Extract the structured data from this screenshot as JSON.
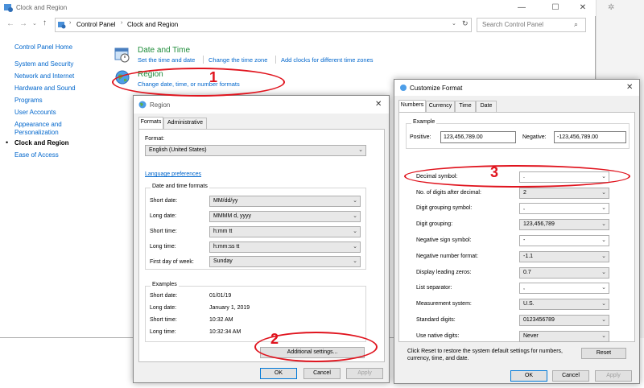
{
  "cp": {
    "title": "Clock and Region",
    "breadcrumb": [
      "Control Panel",
      "Clock and Region"
    ],
    "search_placeholder": "Search Control Panel",
    "nav": [
      "Control Panel Home",
      "System and Security",
      "Network and Internet",
      "Hardware and Sound",
      "Programs",
      "User Accounts",
      "Appearance and Personalization",
      "Clock and Region",
      "Ease of Access"
    ],
    "dt": {
      "heading": "Date and Time",
      "links": [
        "Set the time and date",
        "Change the time zone",
        "Add clocks for different time zones"
      ]
    },
    "region": {
      "heading": "Region",
      "link": "Change date, time, or number formats"
    }
  },
  "region_dlg": {
    "title": "Region",
    "tabs": [
      "Formats",
      "Administrative"
    ],
    "format_label": "Format:",
    "format_value": "English (United States)",
    "lang_pref": "Language preferences",
    "dtf_group": "Date and time formats",
    "rows": [
      {
        "label": "Short date:",
        "value": "MM/dd/yy"
      },
      {
        "label": "Long date:",
        "value": "MMMM d, yyyy"
      },
      {
        "label": "Short time:",
        "value": "h:mm tt"
      },
      {
        "label": "Long time:",
        "value": "h:mm:ss tt"
      },
      {
        "label": "First day of week:",
        "value": "Sunday"
      }
    ],
    "examples_group": "Examples",
    "examples": [
      {
        "label": "Short date:",
        "value": "01/01/19"
      },
      {
        "label": "Long date:",
        "value": "January 1, 2019"
      },
      {
        "label": "Short time:",
        "value": "10:32 AM"
      },
      {
        "label": "Long time:",
        "value": "10:32:34 AM"
      }
    ],
    "additional": "Additional settings...",
    "ok": "OK",
    "cancel": "Cancel",
    "apply": "Apply"
  },
  "cf_dlg": {
    "title": "Customize Format",
    "tabs": [
      "Numbers",
      "Currency",
      "Time",
      "Date"
    ],
    "example_group": "Example",
    "positive_label": "Positive:",
    "positive_value": "123,456,789.00",
    "negative_label": "Negative:",
    "negative_value": "-123,456,789.00",
    "rows": [
      {
        "label": "Decimal symbol:",
        "value": "."
      },
      {
        "label": "No. of digits after decimal:",
        "value": "2"
      },
      {
        "label": "Digit grouping symbol:",
        "value": ","
      },
      {
        "label": "Digit grouping:",
        "value": "123,456,789"
      },
      {
        "label": "Negative sign symbol:",
        "value": "-"
      },
      {
        "label": "Negative number format:",
        "value": "-1.1"
      },
      {
        "label": "Display leading zeros:",
        "value": "0.7"
      },
      {
        "label": "List separator:",
        "value": ","
      },
      {
        "label": "Measurement system:",
        "value": "U.S."
      },
      {
        "label": "Standard digits:",
        "value": "0123456789"
      },
      {
        "label": "Use native digits:",
        "value": "Never"
      }
    ],
    "reset_note": "Click Reset to restore the system default settings for numbers, currency, time, and date.",
    "reset": "Reset",
    "ok": "OK",
    "cancel": "Cancel",
    "apply": "Apply"
  },
  "annotations": [
    "1",
    "2",
    "3"
  ],
  "colors": {
    "annotation": "#e0141e",
    "link": "#0066cc",
    "heading_green": "#1e8c3a"
  }
}
